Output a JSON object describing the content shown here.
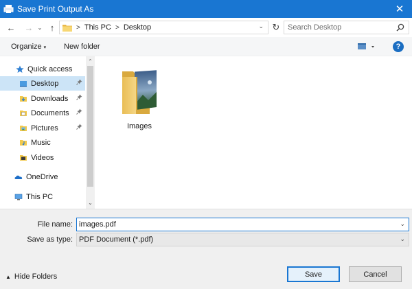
{
  "window": {
    "title": "Save Print Output As",
    "close_symbol": "✕"
  },
  "nav": {
    "back_symbol": "←",
    "forward_symbol": "→",
    "recent_symbol": "⌄",
    "up_symbol": "↑",
    "refresh_symbol": "↻"
  },
  "address": {
    "crumbs": [
      "This PC",
      "Desktop"
    ],
    "separator": ">",
    "dropdown_symbol": "⌄"
  },
  "search": {
    "placeholder": "Search Desktop"
  },
  "toolbar": {
    "organize_label": "Organize",
    "organize_caret": "▾",
    "new_folder_label": "New folder",
    "help_label": "?"
  },
  "sidebar": {
    "items": [
      {
        "label": "Quick access",
        "icon": "star-icon"
      },
      {
        "label": "Desktop",
        "icon": "desktop-folder-icon",
        "pinned": true,
        "selected": true
      },
      {
        "label": "Downloads",
        "icon": "downloads-folder-icon",
        "pinned": true
      },
      {
        "label": "Documents",
        "icon": "documents-folder-icon",
        "pinned": true
      },
      {
        "label": "Pictures",
        "icon": "pictures-folder-icon",
        "pinned": true
      },
      {
        "label": "Music",
        "icon": "music-folder-icon"
      },
      {
        "label": "Videos",
        "icon": "videos-folder-icon"
      },
      {
        "label": "OneDrive",
        "icon": "onedrive-icon"
      },
      {
        "label": "This PC",
        "icon": "computer-icon"
      }
    ],
    "pin_symbol": "📌",
    "scroll_up_symbol": "⌃",
    "scroll_down_symbol": "⌄"
  },
  "files": [
    {
      "name": "Images",
      "type": "folder"
    }
  ],
  "form": {
    "file_name_label": "File name:",
    "file_name_value": "images.pdf",
    "save_type_label": "Save as type:",
    "save_type_value": "PDF Document (*.pdf)",
    "dropdown_symbol": "⌄"
  },
  "footer": {
    "hide_folders_label": "Hide Folders",
    "hide_folders_caret": "▲",
    "save_label": "Save",
    "cancel_label": "Cancel"
  },
  "colors": {
    "titlebar": "#1976d2",
    "selection": "#cce4f7",
    "accent": "#1976d2"
  }
}
